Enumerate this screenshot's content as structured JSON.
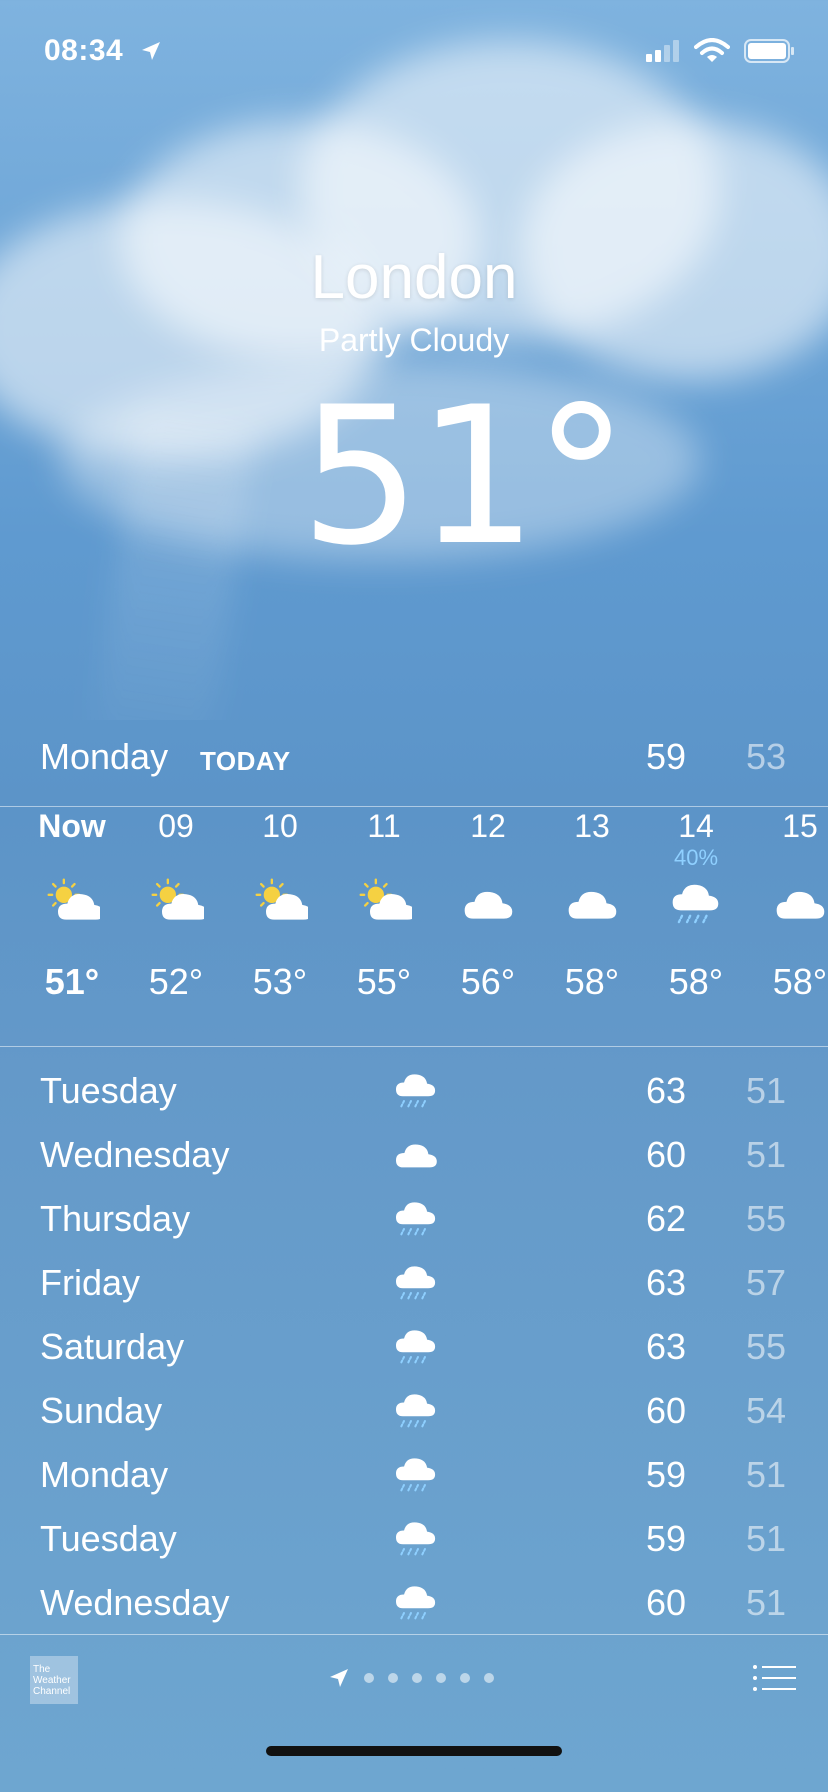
{
  "status_bar": {
    "time": "08:34",
    "icons": [
      "location-arrow-icon",
      "signal-icon",
      "wifi-icon",
      "battery-icon"
    ]
  },
  "header": {
    "city": "London",
    "condition": "Partly Cloudy",
    "temperature": "51°"
  },
  "today": {
    "day": "Monday",
    "tag": "TODAY",
    "high": "59",
    "low": "53"
  },
  "hourly": [
    {
      "label": "Now",
      "precip": "",
      "icon": "partly-cloudy-icon",
      "temp": "51°"
    },
    {
      "label": "09",
      "precip": "",
      "icon": "partly-cloudy-icon",
      "temp": "52°"
    },
    {
      "label": "10",
      "precip": "",
      "icon": "partly-cloudy-icon",
      "temp": "53°"
    },
    {
      "label": "11",
      "precip": "",
      "icon": "partly-cloudy-icon",
      "temp": "55°"
    },
    {
      "label": "12",
      "precip": "",
      "icon": "cloud-icon",
      "temp": "56°"
    },
    {
      "label": "13",
      "precip": "",
      "icon": "cloud-icon",
      "temp": "58°"
    },
    {
      "label": "14",
      "precip": "40%",
      "icon": "rain-cloud-icon",
      "temp": "58°"
    },
    {
      "label": "15",
      "precip": "",
      "icon": "cloud-icon",
      "temp": "58°"
    }
  ],
  "daily": [
    {
      "day": "Tuesday",
      "icon": "rain-cloud-icon",
      "high": "63",
      "low": "51"
    },
    {
      "day": "Wednesday",
      "icon": "cloud-icon",
      "high": "60",
      "low": "51"
    },
    {
      "day": "Thursday",
      "icon": "rain-cloud-icon",
      "high": "62",
      "low": "55"
    },
    {
      "day": "Friday",
      "icon": "rain-cloud-icon",
      "high": "63",
      "low": "57"
    },
    {
      "day": "Saturday",
      "icon": "rain-cloud-icon",
      "high": "63",
      "low": "55"
    },
    {
      "day": "Sunday",
      "icon": "rain-cloud-icon",
      "high": "60",
      "low": "54"
    },
    {
      "day": "Monday",
      "icon": "rain-cloud-icon",
      "high": "59",
      "low": "51"
    },
    {
      "day": "Tuesday",
      "icon": "rain-cloud-icon",
      "high": "59",
      "low": "51"
    },
    {
      "day": "Wednesday",
      "icon": "rain-cloud-icon",
      "high": "60",
      "low": "51"
    }
  ],
  "footer": {
    "logo_text": "The Weather Channel",
    "page_count": 6,
    "icons": [
      "weather-channel-logo",
      "location-arrow-icon",
      "list-icon"
    ]
  },
  "colors": {
    "background_top": "#7fb3df",
    "background_mid": "#5c94c8",
    "low_temp": "#a9c8e6",
    "precip": "#8fd0ff"
  }
}
